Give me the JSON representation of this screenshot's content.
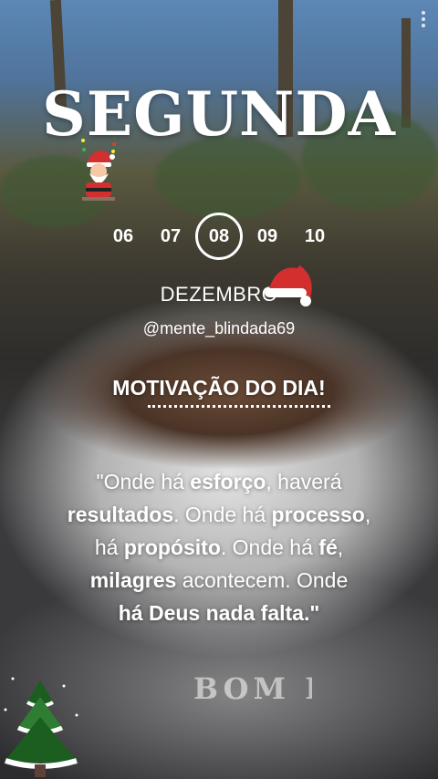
{
  "header": {
    "day": "SEGUNDA"
  },
  "calendar": {
    "dates": [
      "06",
      "07",
      "08",
      "09",
      "10"
    ],
    "selected": "08",
    "month": "DEZEMBRO"
  },
  "handle": "@mente_blindada69",
  "section_title": "MOTIVAÇÃO DO DIA!",
  "quote": {
    "parts": [
      "\"Onde há ",
      "esforço",
      ", haverá ",
      "resultados",
      ". Onde há ",
      "processo",
      ",",
      "há ",
      "propósito",
      ". Onde há ",
      "fé",
      ",",
      "milagres",
      " acontecem. Onde",
      "há Deus nada falta.\""
    ]
  },
  "watermark": "BOM DI",
  "icons": {
    "menu": "more-vert-icon",
    "santa": "santa-sticker-icon",
    "hat": "santa-hat-icon",
    "tree": "christmas-tree-icon"
  }
}
